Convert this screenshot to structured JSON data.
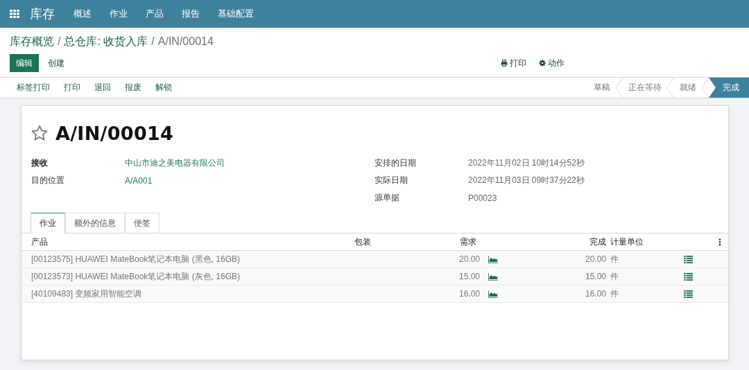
{
  "navbar": {
    "app_title": "库存",
    "menu": [
      "概述",
      "作业",
      "产品",
      "报告",
      "基础配置"
    ]
  },
  "breadcrumb": [
    {
      "label": "库存概览",
      "kind": "link"
    },
    {
      "label": "/",
      "kind": "separator"
    },
    {
      "label": "总仓库: 收货入库",
      "kind": "link"
    },
    {
      "label": "/",
      "kind": "separator"
    },
    {
      "label": "A/IN/00014",
      "kind": "current"
    }
  ],
  "control_buttons": [
    {
      "label": "编辑",
      "kind": "primary"
    },
    {
      "label": "创建",
      "kind": "secondary"
    }
  ],
  "sidebar_buttons": [
    {
      "label": "打印",
      "kind": "print"
    },
    {
      "label": "动作",
      "kind": "gear"
    }
  ],
  "header_buttons": [
    "标签打印",
    "打印",
    "退回",
    "报废",
    "解锁"
  ],
  "status_steps": [
    {
      "label": "草稿",
      "selected": false
    },
    {
      "label": "正在等待",
      "selected": false
    },
    {
      "label": "就绪",
      "selected": false
    },
    {
      "label": "完成",
      "selected": true
    }
  ],
  "record": {
    "title": "A/IN/00014",
    "starred": false,
    "left_fields": [
      {
        "label": "接收",
        "value": "中山市迪之美电器有限公司",
        "link": true,
        "strong": true
      },
      {
        "label": "目的位置",
        "value": "A/A001",
        "link": true,
        "strong": false
      }
    ],
    "right_fields": [
      {
        "label": "安排的日期",
        "value": "2022年11月02日 10时14分52秒",
        "link": false,
        "strong": false
      },
      {
        "label": "实际日期",
        "value": "2022年11月03日 09时37分22秒",
        "link": false,
        "strong": false
      },
      {
        "label": "源单据",
        "value": "P00023",
        "link": false,
        "strong": false
      }
    ]
  },
  "tabs": [
    {
      "label": "作业",
      "selected": true
    },
    {
      "label": "额外的信息",
      "selected": false
    },
    {
      "label": "便签",
      "selected": false
    }
  ],
  "table": {
    "columns": [
      "产品",
      "包装",
      "需求",
      "完成",
      "计量单位"
    ],
    "rows": [
      {
        "product": "[00123575] HUAWEI MateBook笔记本电脑 (黑色, 16GB)",
        "demand": "20.00",
        "done": "20.00",
        "uom": "件"
      },
      {
        "product": "[00123573] HUAWEI MateBook笔记本电脑 (灰色, 16GB)",
        "demand": "15.00",
        "done": "15.00",
        "uom": "件"
      },
      {
        "product": "[40109483] 变频家用智能空调",
        "demand": "16.00",
        "done": "16.00",
        "uom": "件"
      }
    ]
  }
}
